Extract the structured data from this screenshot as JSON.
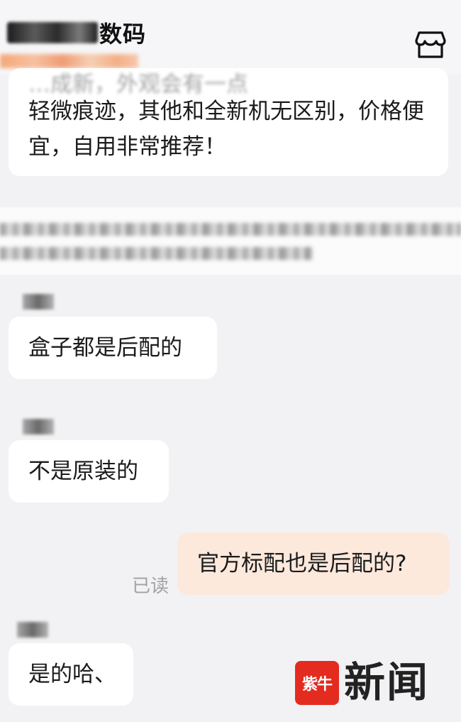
{
  "header": {
    "shop_name": "数码",
    "store_icon": "store-icon"
  },
  "messages": [
    {
      "sender": "seller",
      "faded_line": "…成新，外观会有一点",
      "text": "轻微痕迹，其他和全新机无区别，价格便宜，自用非常推荐！"
    },
    {
      "sender": "seller",
      "text": "盒子都是后配的"
    },
    {
      "sender": "seller",
      "text": "不是原装的"
    },
    {
      "sender": "me",
      "text": "官方标配也是后配的?",
      "status": "已读"
    },
    {
      "sender": "seller",
      "text": "是的哈、"
    }
  ],
  "watermark": {
    "logo_text": "紫牛",
    "text": "新闻"
  },
  "colors": {
    "background": "#f2f2f4",
    "seller_bubble": "#ffffff",
    "my_bubble": "#fde8dc",
    "watermark_red": "#e42b20"
  }
}
